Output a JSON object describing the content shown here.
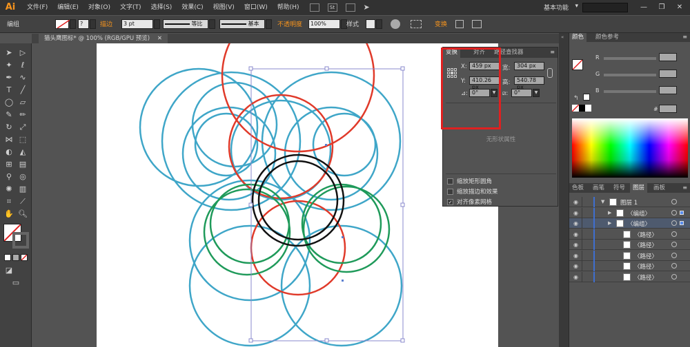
{
  "app": {
    "logo": "Ai"
  },
  "menubar": {
    "items": [
      "文件(F)",
      "编辑(E)",
      "对象(O)",
      "文字(T)",
      "选择(S)",
      "效果(C)",
      "视图(V)",
      "窗口(W)",
      "帮助(H)"
    ],
    "workspace": "基本功能",
    "workspace_arrow": "▾",
    "window_buttons": [
      "—",
      "❐",
      "✕"
    ],
    "icons": [
      "bridge-icon",
      "stock-icon",
      "arrange-icon",
      "gpu-icon"
    ],
    "stock_label": "St"
  },
  "controlbar": {
    "selection_label": "编组",
    "stroke_label": "描边",
    "stroke_weight": "3 pt",
    "profile_label": "等比",
    "brush_label": "基本",
    "opacity_label": "不透明度",
    "opacity_value": "100%",
    "style_label": "样式",
    "transform_link": "变换"
  },
  "document": {
    "tab_title": "猫头鹰图标* @ 100% (RGB/GPU 预览)",
    "tab_close": "✕"
  },
  "transform_panel": {
    "tabs": [
      "变换",
      "对齐",
      "路径查找器"
    ],
    "x_label": "X:",
    "x_value": "459 px",
    "y_label": "Y:",
    "y_value": "410.26 px",
    "w_label": "宽:",
    "w_value": "304 px",
    "h_label": "高:",
    "h_value": "540.78 px",
    "rotate_label": "⊿:",
    "rotate_value": "0°",
    "shear_label": "⧄:",
    "shear_value": "0°",
    "no_shape": "无形状属性",
    "checkboxes": [
      {
        "label": "缩放矩形圆角",
        "checked": false
      },
      {
        "label": "缩放描边和效果",
        "checked": false
      },
      {
        "label": "对齐像素网格",
        "checked": true
      }
    ],
    "check_mark": "✓"
  },
  "color_panel": {
    "tabs": [
      "颜色",
      "颜色参考"
    ],
    "channels": [
      "R",
      "G",
      "B"
    ],
    "hash_label": "#"
  },
  "layers_panel": {
    "tabs": [
      "色板",
      "画笔",
      "符号",
      "图层",
      "画板"
    ],
    "rows": [
      {
        "name": "图层 1",
        "indent": 0,
        "expanded": true,
        "selected": false
      },
      {
        "name": "〈编组〉",
        "indent": 1,
        "expanded": false,
        "selected": false
      },
      {
        "name": "〈编组〉",
        "indent": 1,
        "expanded": false,
        "selected": true
      },
      {
        "name": "〈路径〉",
        "indent": 2,
        "expanded": false,
        "selected": false
      },
      {
        "name": "〈路径〉",
        "indent": 2,
        "expanded": false,
        "selected": false
      },
      {
        "name": "〈路径〉",
        "indent": 2,
        "expanded": false,
        "selected": false
      },
      {
        "name": "〈路径〉",
        "indent": 2,
        "expanded": false,
        "selected": false
      },
      {
        "name": "〈路径〉",
        "indent": 2,
        "expanded": false,
        "selected": false
      }
    ]
  },
  "colors": {
    "red_circle": "#e03a2a",
    "teal_circle": "#3fa6c8",
    "green_circle": "#1f9a5a",
    "black_circle": "#111111",
    "selection": "#8888cc",
    "highlight": "#e02020"
  }
}
